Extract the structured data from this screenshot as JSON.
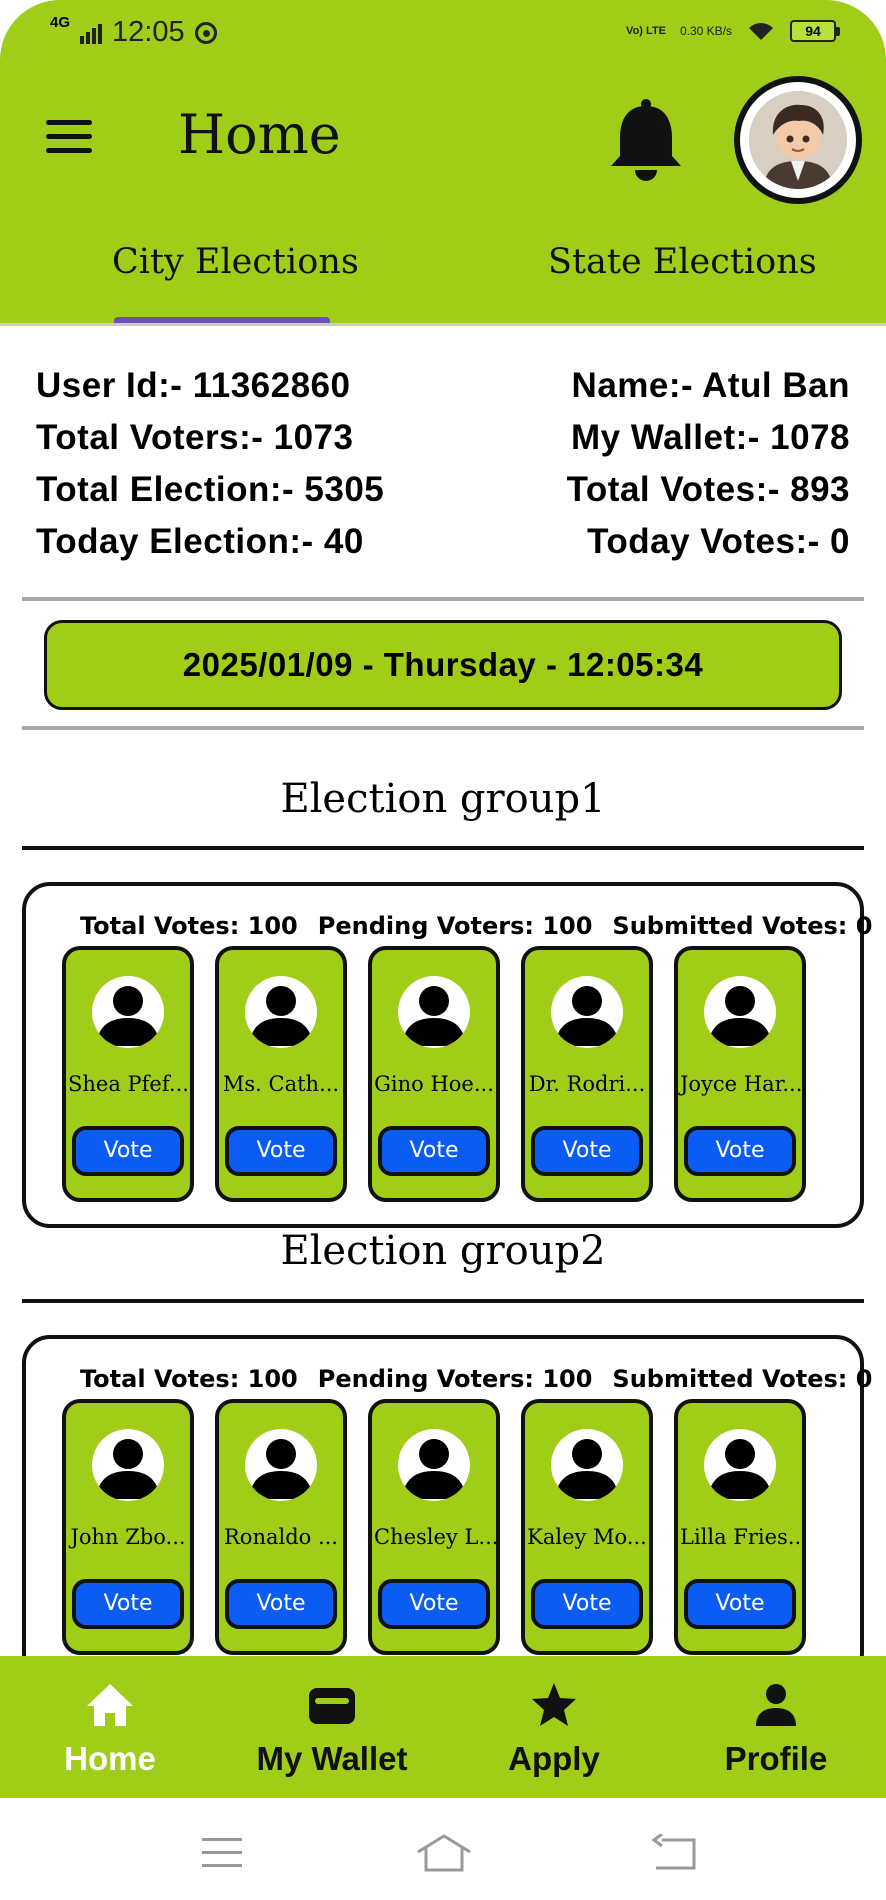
{
  "status_bar": {
    "network": "4G",
    "time": "12:05",
    "volte": "Vo) LTE",
    "speed": "0.30 KB/s",
    "battery": "94"
  },
  "header": {
    "title": "Home"
  },
  "tabs": [
    {
      "label": "City Elections",
      "active": true
    },
    {
      "label": "State Elections",
      "active": false
    }
  ],
  "user_info": {
    "left": [
      "User Id:- 11362860",
      "Total Voters:- 1073",
      "Total Election:- 5305",
      "Today Election:- 40"
    ],
    "right": [
      "Name:- Atul Ban",
      "My Wallet:- 1078",
      "Total Votes:- 893",
      "Today Votes:- 0"
    ]
  },
  "datetime": "2025/01/09 - Thursday - 12:05:34",
  "groups": [
    {
      "title": "Election group1",
      "total_votes": "Total Votes: 100",
      "pending_voters": "Pending Voters: 100",
      "submitted_votes": "Submitted Votes: 0",
      "candidates": [
        {
          "name": "Shea Pfef...",
          "vote_label": "Vote"
        },
        {
          "name": "Ms. Cath...",
          "vote_label": "Vote"
        },
        {
          "name": "Gino Hoe...",
          "vote_label": "Vote"
        },
        {
          "name": "Dr. Rodri...",
          "vote_label": "Vote"
        },
        {
          "name": "Joyce Har...",
          "vote_label": "Vote"
        }
      ]
    },
    {
      "title": "Election group2",
      "total_votes": "Total Votes: 100",
      "pending_voters": "Pending Voters: 100",
      "submitted_votes": "Submitted Votes: 0",
      "candidates": [
        {
          "name": "John Zbo...",
          "vote_label": "Vote"
        },
        {
          "name": "Ronaldo ...",
          "vote_label": "Vote"
        },
        {
          "name": "Chesley L...",
          "vote_label": "Vote"
        },
        {
          "name": "Kaley Mo...",
          "vote_label": "Vote"
        },
        {
          "name": "Lilla Fries...",
          "vote_label": "Vote"
        }
      ]
    }
  ],
  "bottom_nav": [
    {
      "label": "Home",
      "icon": "home-icon",
      "active": true
    },
    {
      "label": "My Wallet",
      "icon": "wallet-icon",
      "active": false
    },
    {
      "label": "Apply",
      "icon": "star-icon",
      "active": false
    },
    {
      "label": "Profile",
      "icon": "person-icon",
      "active": false
    }
  ],
  "colors": {
    "accent": "#9fcd18",
    "tab_indicator": "#6b4fbc",
    "vote_button": "#0b5cf3"
  }
}
